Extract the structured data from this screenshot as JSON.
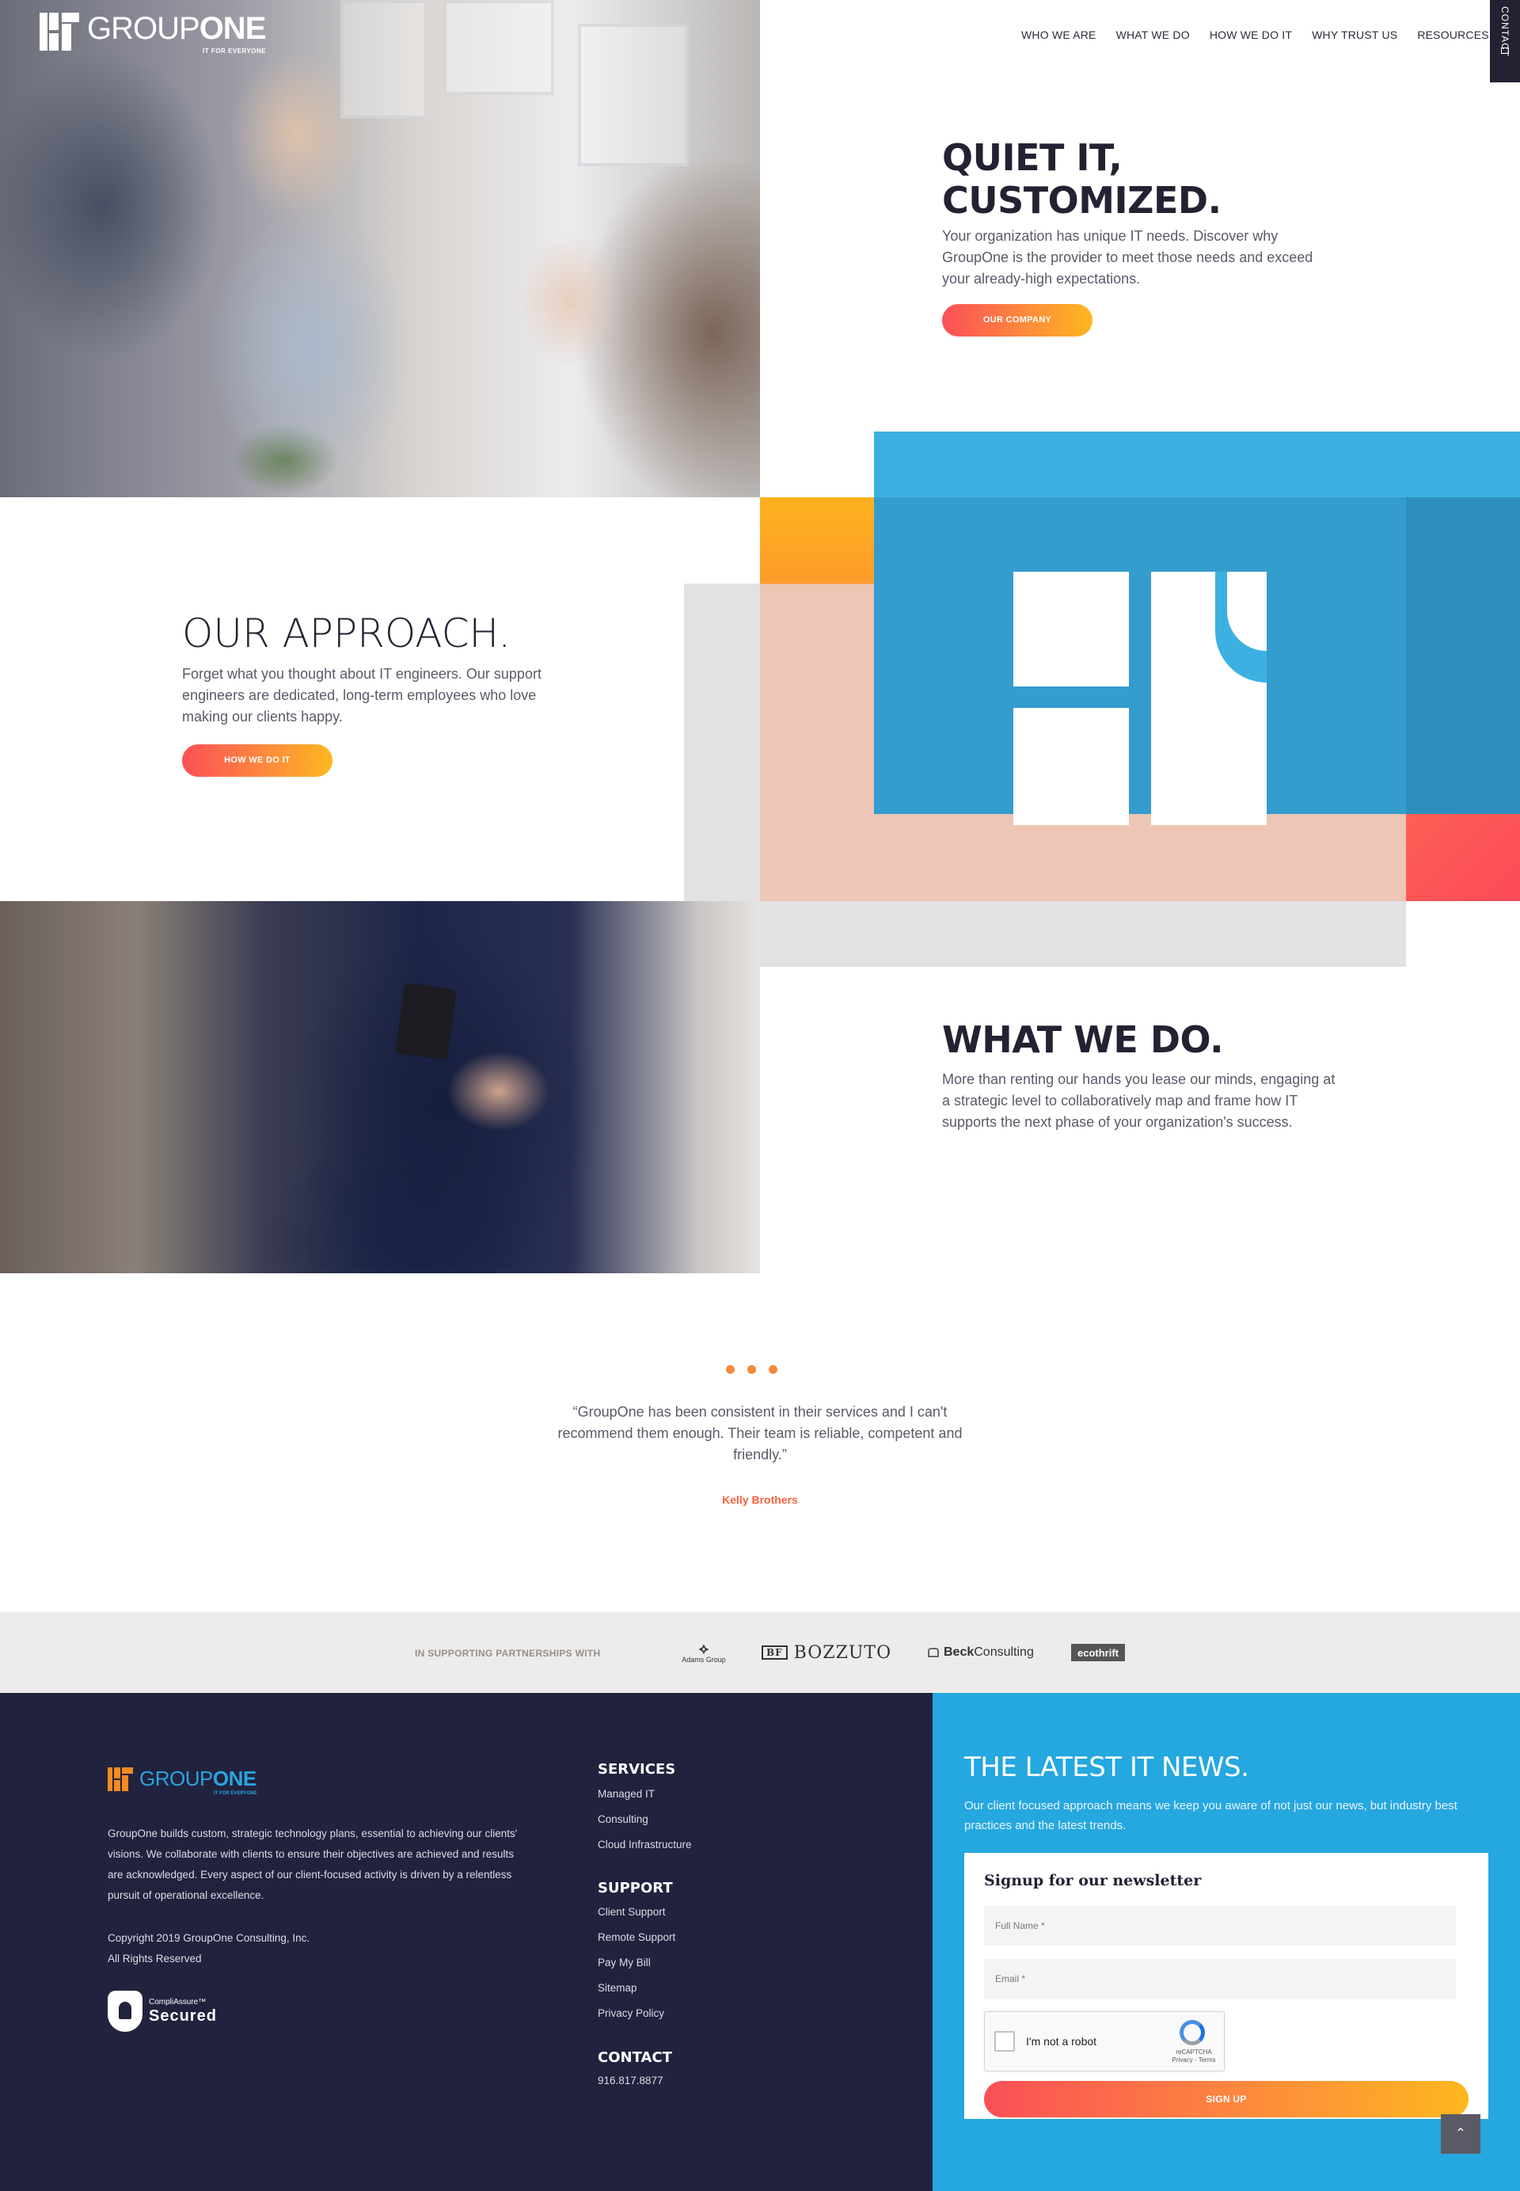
{
  "brand": {
    "name_light": "GROUP",
    "name_bold": "ONE",
    "tagline": "IT FOR EVERYONE",
    "accent_orange": "#f58a1f",
    "accent_blue": "#29a4dd",
    "gradient_start": "#fb4f57",
    "gradient_end": "#fdb71f"
  },
  "nav": {
    "items": [
      {
        "label": "WHO WE ARE"
      },
      {
        "label": "WHAT WE DO"
      },
      {
        "label": "HOW WE DO IT"
      },
      {
        "label": "WHY TRUST US"
      },
      {
        "label": "RESOURCES"
      }
    ],
    "contact_tab": "CONTACT",
    "contact_icon": "envelope-icon"
  },
  "hero": {
    "title_line1": "QUIET IT,",
    "title_line2": "CUSTOMIZED.",
    "text": "Your organization has unique IT needs. Discover why GroupOne is the provider to meet those needs and exceed your already-high expectations.",
    "button": "OUR COMPANY"
  },
  "approach": {
    "title": "OUR APPROACH.",
    "text": "Forget what you thought about IT engineers. Our support engineers are dedicated, long-term employees who love making our clients happy.",
    "button": "HOW WE DO IT"
  },
  "what_we_do": {
    "title": "WHAT WE DO.",
    "text": "More than renting our hands you lease our minds, engaging at a strategic level to collaboratively map and frame how IT supports the next phase of your organization's success."
  },
  "testimonial": {
    "quote": "“GroupOne has been consistent in their services and I can't recommend them enough. Their team is reliable, competent and friendly.”",
    "author": "Kelly Brothers"
  },
  "partners": {
    "label": "IN SUPPORTING PARTNERSHIPS WITH",
    "adams_mark": "⟡",
    "adams": "Adams Group",
    "bozzuto_mark": "BF",
    "bozzuto": "BOZZUTO",
    "beck_bold": "Beck",
    "beck_rest": "Consulting",
    "ecothrift": "ecothrift"
  },
  "footer": {
    "about": "GroupOne builds custom, strategic technology plans, essential to achieving our clients' visions. We collaborate with clients to ensure their objectives are achieved and results are acknowledged. Every aspect of our client-focused activity is driven by a relentless pursuit of operational excellence.",
    "copyright": "Copyright 2019 GroupOne Consulting, Inc.",
    "rights": "All Rights Reserved",
    "badge_top": "CompliAssure™",
    "badge_main": "Secured",
    "services_title": "SERVICES",
    "services": [
      "Managed IT",
      "Consulting",
      "Cloud Infrastructure"
    ],
    "support_title": "SUPPORT",
    "support": [
      "Client Support",
      "Remote Support",
      "Pay My Bill",
      "Sitemap",
      "Privacy Policy"
    ],
    "contact_title": "CONTACT",
    "phone": "916.817.8877"
  },
  "newsletter": {
    "title": "THE LATEST IT NEWS.",
    "text": "Our client focused approach means we keep you aware of not just our news, but industry best practices and the latest trends.",
    "card_title": "Signup for our newsletter",
    "name_placeholder": "Full Name *",
    "email_placeholder": "Email *",
    "captcha_label": "I'm not a robot",
    "captcha_brand": "reCAPTCHA",
    "captcha_links": "Privacy - Terms",
    "button": "SIGN UP"
  },
  "scroll_top_icon": "⌃"
}
